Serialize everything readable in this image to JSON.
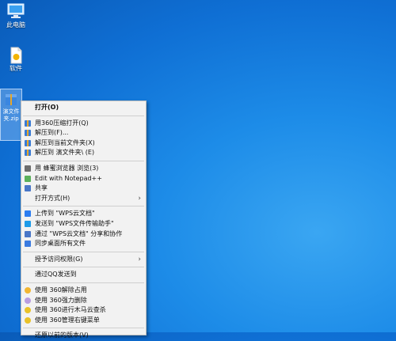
{
  "desktop": {
    "icons": [
      {
        "label": "此电脑",
        "icon": "computer-icon"
      },
      {
        "label": "软件",
        "icon": "file-icon"
      }
    ],
    "selected_file": {
      "label": "演文件夹.zip",
      "icon": "archive-icon"
    }
  },
  "context_menu": {
    "groups": [
      [
        {
          "label": "打开(O)",
          "icon": "",
          "bold": true
        }
      ],
      [
        {
          "label": "用360压缩打开(Q)",
          "icon": "archive-icon"
        },
        {
          "label": "解压到(F)...",
          "icon": "archive-icon"
        },
        {
          "label": "解压到当前文件夹(X)",
          "icon": "archive-icon"
        },
        {
          "label": "解压到 演文件夹\\ (E)",
          "icon": "archive-icon"
        }
      ],
      [
        {
          "label": "用 蜂蜜浏览器 浏览(3)",
          "icon": "browser-icon"
        },
        {
          "label": "Edit with Notepad++",
          "icon": "notepad-icon"
        },
        {
          "label": "共享",
          "icon": "share-icon"
        },
        {
          "label": "打开方式(H)",
          "icon": "",
          "submenu": true
        }
      ],
      [
        {
          "label": "上传到 \"WPS云文档\"",
          "icon": "cloud-icon"
        },
        {
          "label": "发送到 \"WPS文件传输助手\"",
          "icon": "send-icon"
        },
        {
          "label": "通过 \"WPS云文档\" 分享和协作",
          "icon": "share-icon"
        },
        {
          "label": "同步桌面所有文件",
          "icon": "sync-icon"
        }
      ],
      [
        {
          "label": "授予访问权限(G)",
          "icon": "",
          "submenu": true
        }
      ],
      [
        {
          "label": "通过QQ发送到",
          "icon": ""
        }
      ],
      [
        {
          "label": "使用 360解除占用",
          "icon": "unlock-icon"
        },
        {
          "label": "使用 360强力删除",
          "icon": "delete-icon"
        },
        {
          "label": "使用 360进行木马云查杀",
          "icon": "shield-icon"
        },
        {
          "label": "使用 360管理右键菜单",
          "icon": "shield-icon"
        }
      ],
      [
        {
          "label": "还原以前的版本(V)",
          "icon": ""
        }
      ]
    ]
  },
  "colors": {
    "archive": "#3a7bd5",
    "archive2": "#e6a72a",
    "browser": "#6d6d6d",
    "notepad": "#5bb05b",
    "share": "#4a77c7",
    "cloud": "#2d7df0",
    "send": "#1e9be8",
    "sync": "#3b7be0",
    "unlock": "#f2b632",
    "delete": "#b99de0",
    "shield": "#e9c229"
  }
}
